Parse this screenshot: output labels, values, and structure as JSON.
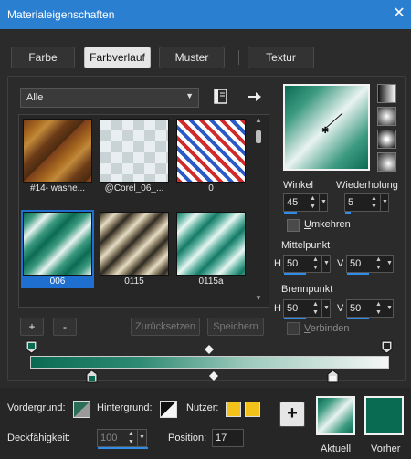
{
  "window": {
    "title": "Materialeigenschaften",
    "close_glyph": "✕"
  },
  "tabs": [
    {
      "label": "Farbe"
    },
    {
      "label": "Farbverlauf",
      "active": true
    },
    {
      "label": "Muster"
    },
    {
      "label": "Textur"
    }
  ],
  "gallery": {
    "category": "Alle",
    "items": [
      {
        "label": "#14- washe..."
      },
      {
        "label": "@Corel_06_..."
      },
      {
        "label": "0"
      },
      {
        "label": "006",
        "selected": true
      },
      {
        "label": "0115"
      },
      {
        "label": "0115a"
      }
    ],
    "add_label": "+",
    "remove_label": "-",
    "reset_label": "Zurücksetzen",
    "save_label": "Speichern"
  },
  "settings": {
    "winkel_label": "Winkel",
    "winkel_value": "45",
    "wiederholung_label": "Wiederholung",
    "wiederholung_value": "5",
    "umkehren_label_first": "U",
    "umkehren_label_rest": "mkehren",
    "mittelpunkt_label": "Mittelpunkt",
    "mittel_h_label": "H",
    "mittel_h_value": "50",
    "mittel_v_label": "V",
    "mittel_v_value": "50",
    "brennpunkt_label": "Brennpunkt",
    "brenn_h_label": "H",
    "brenn_h_value": "50",
    "brenn_v_label": "V",
    "brenn_v_value": "50",
    "verbinden_label_first": "V",
    "verbinden_label_rest": "erbinden"
  },
  "bottom": {
    "vordergrund_label": "Vordergrund:",
    "hintergrund_label": "Hintergrund:",
    "nutzer_label": "Nutzer:",
    "deckfaehigkeit_label": "Deckfähigkeit:",
    "deckfaehigkeit_value": "100",
    "position_label": "Position:",
    "position_value": "17",
    "add_label": "+",
    "aktuell_label": "Aktuell",
    "vorher_label": "Vorher"
  },
  "colors": {
    "accent": "#2b7fd1",
    "teal": "#0a6b53",
    "user_yellow": "#f2c21b"
  }
}
